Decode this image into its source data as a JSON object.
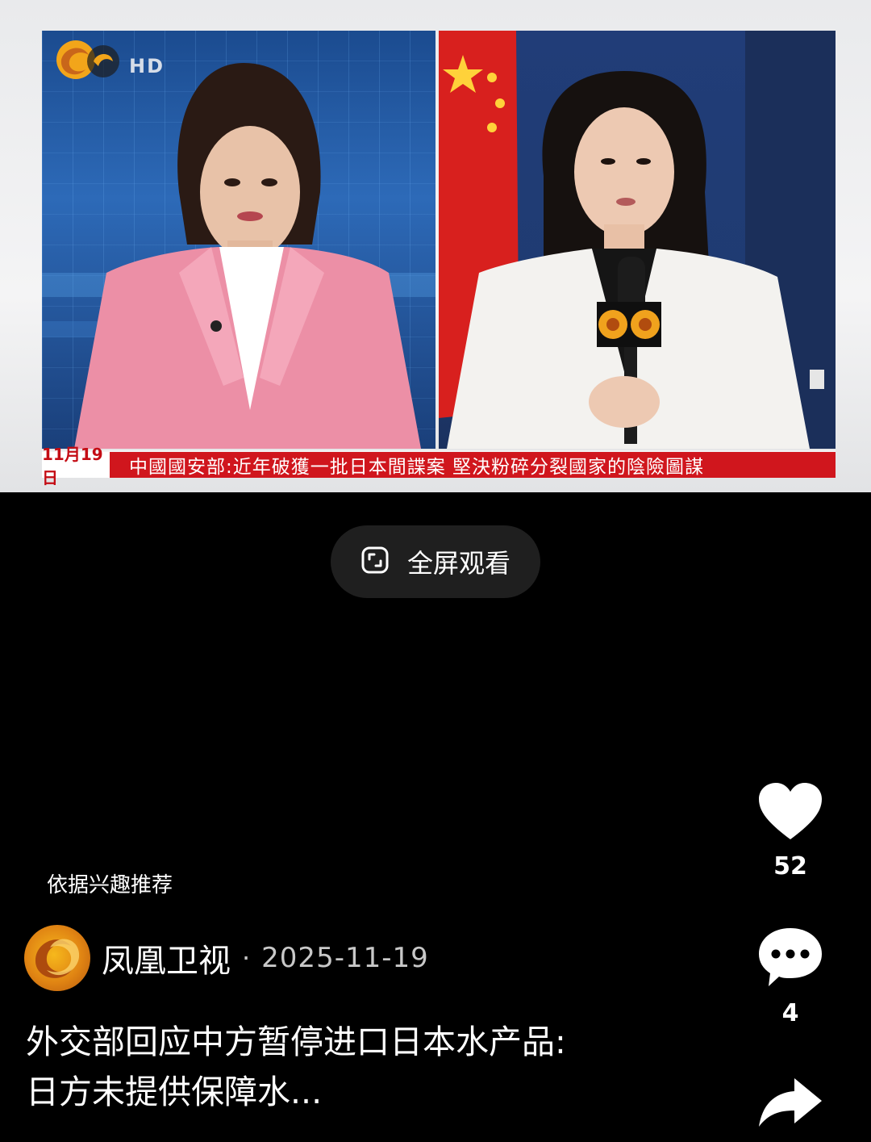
{
  "video": {
    "hd_label": "HD",
    "ticker_date": "11月19日",
    "ticker_text": "中國國安部:近年破獲一批日本間諜案  堅決粉碎分裂國家的陰險圖謀"
  },
  "fullscreen": {
    "label": "全屏观看",
    "icon": "fullscreen-icon"
  },
  "actions": {
    "like": {
      "icon": "heart-icon",
      "count": "52"
    },
    "comment": {
      "icon": "comment-icon",
      "count": "4"
    },
    "share": {
      "icon": "share-icon"
    }
  },
  "feed": {
    "recommend_label": "依据兴趣推荐",
    "author": "凤凰卫视",
    "separator": "·",
    "date": "2025-11-19",
    "caption_line1": "外交部回应中方暂停进口日本水产品:",
    "caption_line2": "日方未提供保障水..."
  },
  "colors": {
    "ticker_red": "#d0161d",
    "brand_orange": "#e08413",
    "pill_bg": "#1f1f1f"
  }
}
